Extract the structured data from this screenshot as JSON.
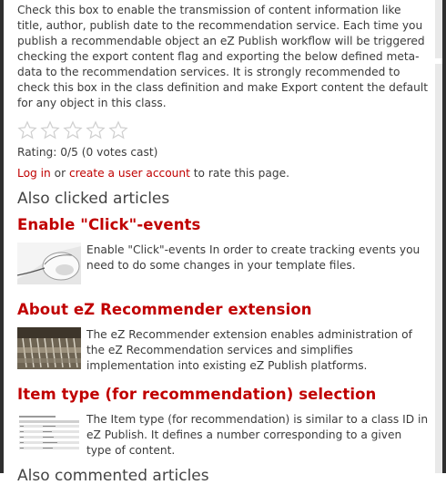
{
  "intro": "Check this box to enable the transmission of content information like title, author, publish date to the recommendation service. Each time you publish a recommendable object an eZ Publish workflow will be triggered checking the export content flag and exporting the below defined meta-data to the recommendation services. It is strongly recommended to check this box in the class definition and make Export content the default for any object in this class.",
  "rating": {
    "text": "Rating: 0/5 (0 votes cast)",
    "stars_filled": 0,
    "stars_total": 5,
    "login_link": "Log in",
    "or_text": "or",
    "create_link": "create a user account",
    "suffix": "to rate this page."
  },
  "also_clicked": {
    "title": "Also clicked articles",
    "articles": [
      {
        "title": "Enable \"Click\"-events",
        "description": "Enable \"Click\"-events In order to create tracking events you need to do some changes in your template files.",
        "thumb_icon": "mouse-photo"
      },
      {
        "title": "About eZ Recommender extension",
        "description": "The eZ Recommender extension enables administration of the eZ Recommendation services and simplifies implementation into existing eZ Publish platforms.",
        "thumb_icon": "server-photo"
      },
      {
        "title": "Item type (for recommendation) selection",
        "description": "The Item type (for recommendation) is similar to a class ID in eZ Publish. It defines a number corresponding to a given type of content.",
        "thumb_icon": "table-screenshot"
      }
    ]
  },
  "next_section_title": "Also commented articles"
}
